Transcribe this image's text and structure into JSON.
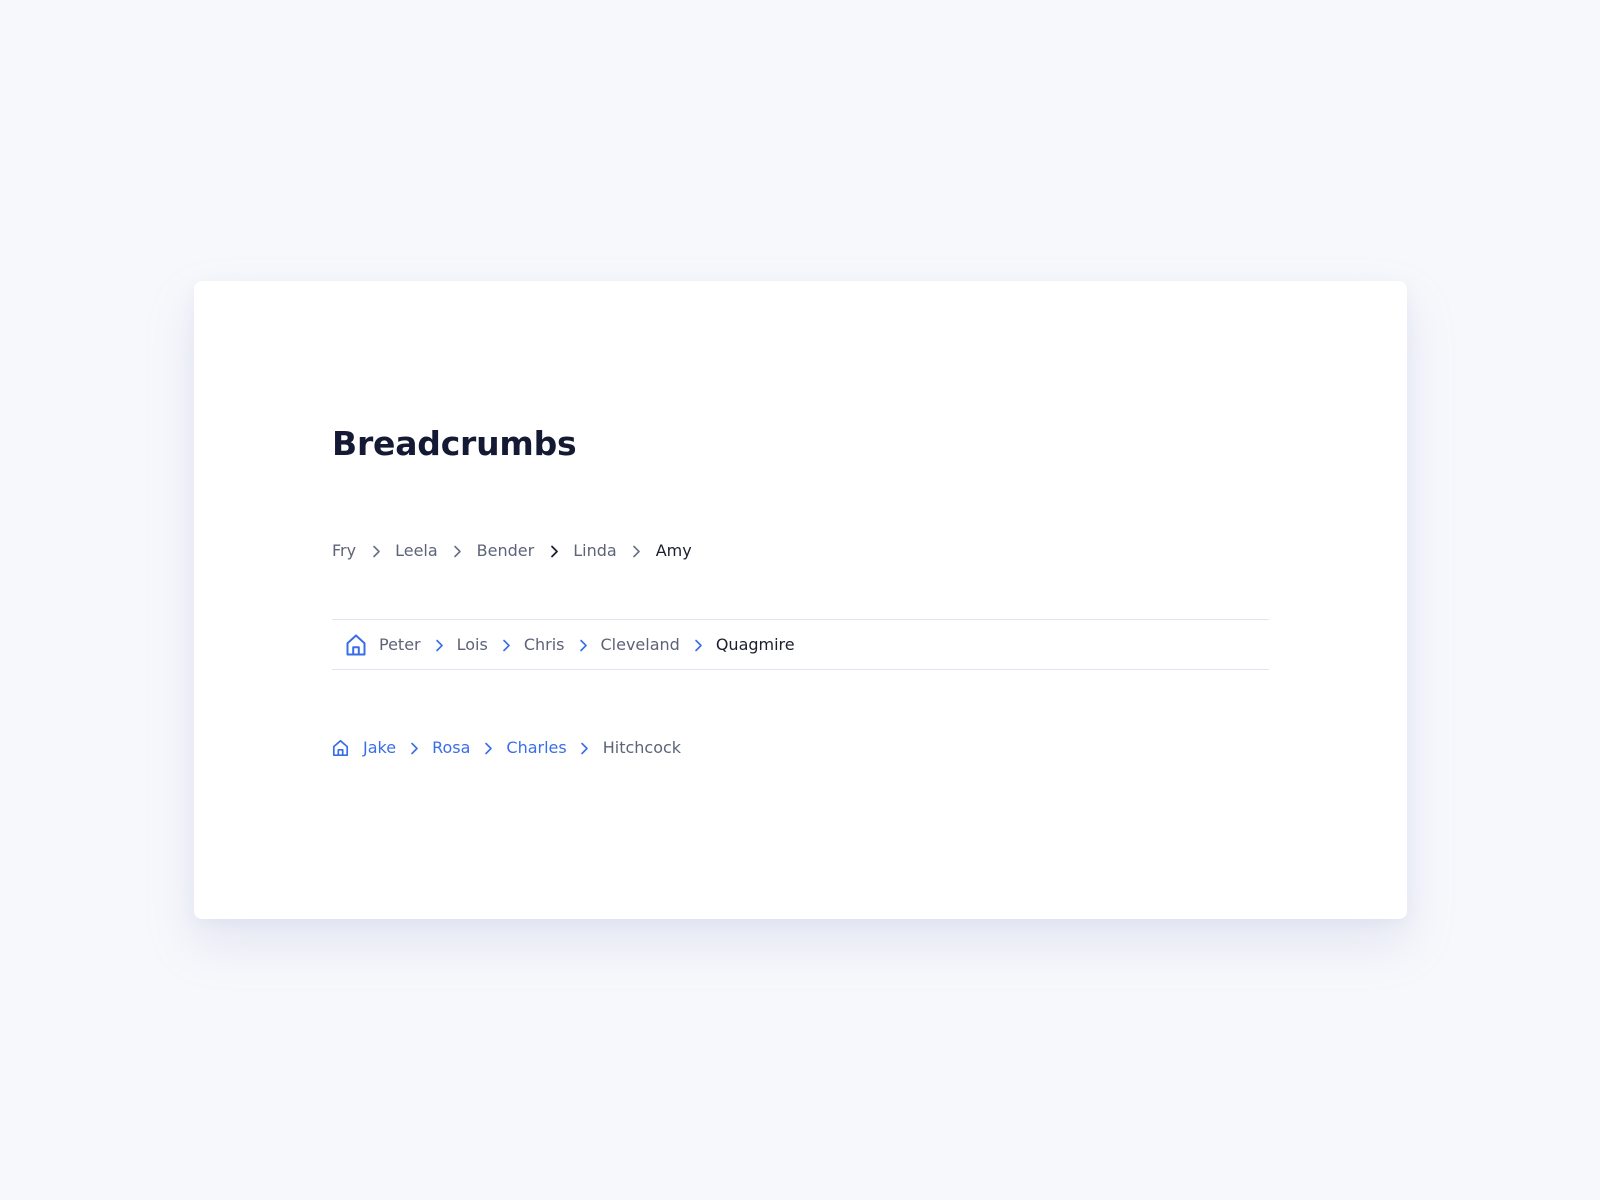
{
  "page": {
    "title": "Breadcrumbs"
  },
  "colors": {
    "background": "#f7f8fc",
    "card": "#ffffff",
    "text_muted": "#5d6378",
    "text_current": "#1b1f2e",
    "accent": "#3a6ee8",
    "divider": "#e2e5ef"
  },
  "breadcrumbs_simple": {
    "items": [
      "Fry",
      "Leela",
      "Bender",
      "Linda"
    ],
    "current": "Amy",
    "separator_icon": "chevron-right-icon"
  },
  "breadcrumbs_bordered": {
    "home_icon": "home-icon",
    "items": [
      "Peter",
      "Lois",
      "Chris",
      "Cleveland"
    ],
    "current": "Quagmire",
    "separator_icon": "chevron-right-icon"
  },
  "breadcrumbs_accent": {
    "home_icon": "home-icon",
    "items": [
      "Jake",
      "Rosa",
      "Charles"
    ],
    "current": "Hitchcock",
    "separator_icon": "chevron-right-icon"
  }
}
